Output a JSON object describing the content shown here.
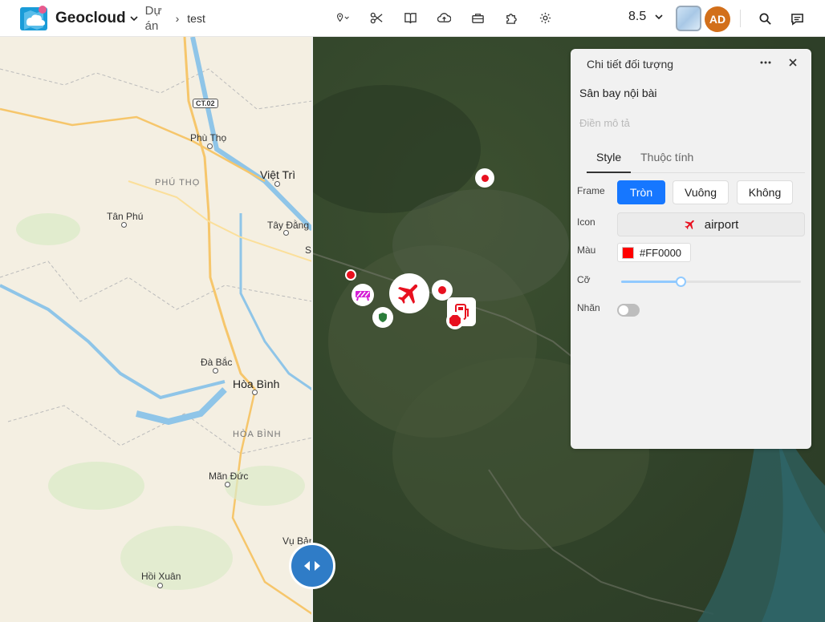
{
  "header": {
    "brand": "Geocloud",
    "project_label": "Dự án",
    "crumb_sep": "›",
    "project_name": "test",
    "zoom": "8.5",
    "avatar": "AD",
    "tools": [
      "location-pin-icon",
      "scissors-icon",
      "book-icon",
      "cloud-upload-icon",
      "toolbox-icon",
      "puzzle-icon",
      "settings-icon"
    ]
  },
  "map": {
    "labels": {
      "ct02": "CT.02",
      "phu_tho_city": "Phù Thọ",
      "phu_tho_region": "PHÚ THỌ",
      "viet_tri": "Việt Trì",
      "tan_phu": "Tân Phú",
      "tay_dang": "Tây Đằng",
      "s_partial": "S",
      "da_bac": "Đà Bắc",
      "hoa_binh_city": "Hòa Bình",
      "hoa_binh_region": "HÒA BÌNH",
      "man_duc": "Mãn Đức",
      "vu_ban": "Vụ Bản",
      "hoi_xuan": "Hồi Xuân"
    }
  },
  "panel": {
    "title": "Chi tiết đối tượng",
    "object_name": "Sân bay nội bài",
    "desc_placeholder": "Điền mô tả",
    "tabs": [
      "Style",
      "Thuộc tính"
    ],
    "active_tab": "Style",
    "frame_label": "Frame",
    "frame_options": [
      "Tròn",
      "Vuông",
      "Không"
    ],
    "frame_selected": "Tròn",
    "icon_label": "Icon",
    "icon_value": "airport",
    "color_label": "Màu",
    "color_value": "#FF0000",
    "size_label": "Cỡ",
    "size_fraction": 0.33,
    "label_label": "Nhãn",
    "label_enabled": false
  }
}
